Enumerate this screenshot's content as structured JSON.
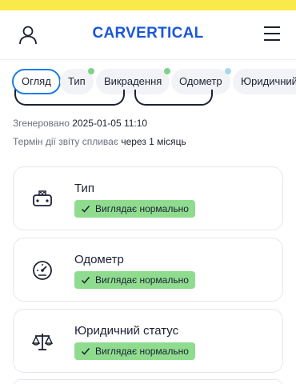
{
  "header": {
    "logo": "CARVERTICAL",
    "user_icon": "user-icon",
    "menu_icon": "hamburger-menu-icon"
  },
  "tabs": [
    {
      "label": "Огляд",
      "active": true
    },
    {
      "label": "Тип",
      "dot_color": "#7ed38a"
    },
    {
      "label": "Викрадення",
      "dot_color": "#7ed38a"
    },
    {
      "label": "Одометр",
      "dot_color": "#a8d8f0"
    },
    {
      "label": "Юридичний"
    }
  ],
  "report": {
    "generated_label": "Згенеровано",
    "generated_value": "2025-01-05 11:10",
    "expiry_label": "Термін дії звіту спливає",
    "expiry_value": "через 1 місяць"
  },
  "cards": [
    {
      "title": "Тип",
      "badge": "Виглядає нормально",
      "icon": "taxi-icon"
    },
    {
      "title": "Одометр",
      "badge": "Виглядає нормально",
      "icon": "speedometer-icon"
    },
    {
      "title": "Юридичний статус",
      "badge": "Виглядає нормально",
      "icon": "scales-icon"
    }
  ],
  "colors": {
    "accent": "#1e7be8",
    "logo": "#1a56db",
    "top_strip": "#fae94b",
    "badge_ok": "#8fdc8f"
  }
}
